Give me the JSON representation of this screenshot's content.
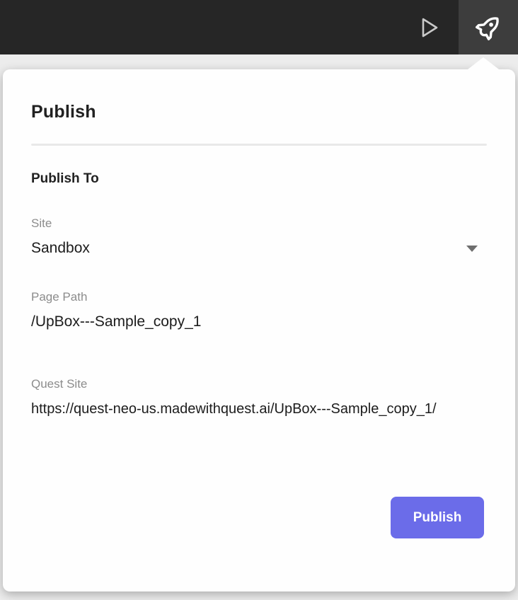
{
  "topbar": {
    "bg_color": "#262626",
    "active_button_bg": "#3d3d3d",
    "buttons": [
      {
        "icon": "play-icon"
      },
      {
        "icon": "rocket-icon",
        "active": true
      }
    ]
  },
  "popover": {
    "title": "Publish",
    "section_title": "Publish To",
    "site": {
      "label": "Site",
      "value": "Sandbox",
      "control": "dropdown"
    },
    "page_path": {
      "label": "Page Path",
      "value": "/UpBox---Sample_copy_1"
    },
    "quest_site": {
      "label": "Quest Site",
      "value": "https://quest-neo-us.madewithquest.ai/UpBox---Sample_copy_1/"
    },
    "publish_button_label": "Publish",
    "accent_color": "#6b6ce9"
  }
}
